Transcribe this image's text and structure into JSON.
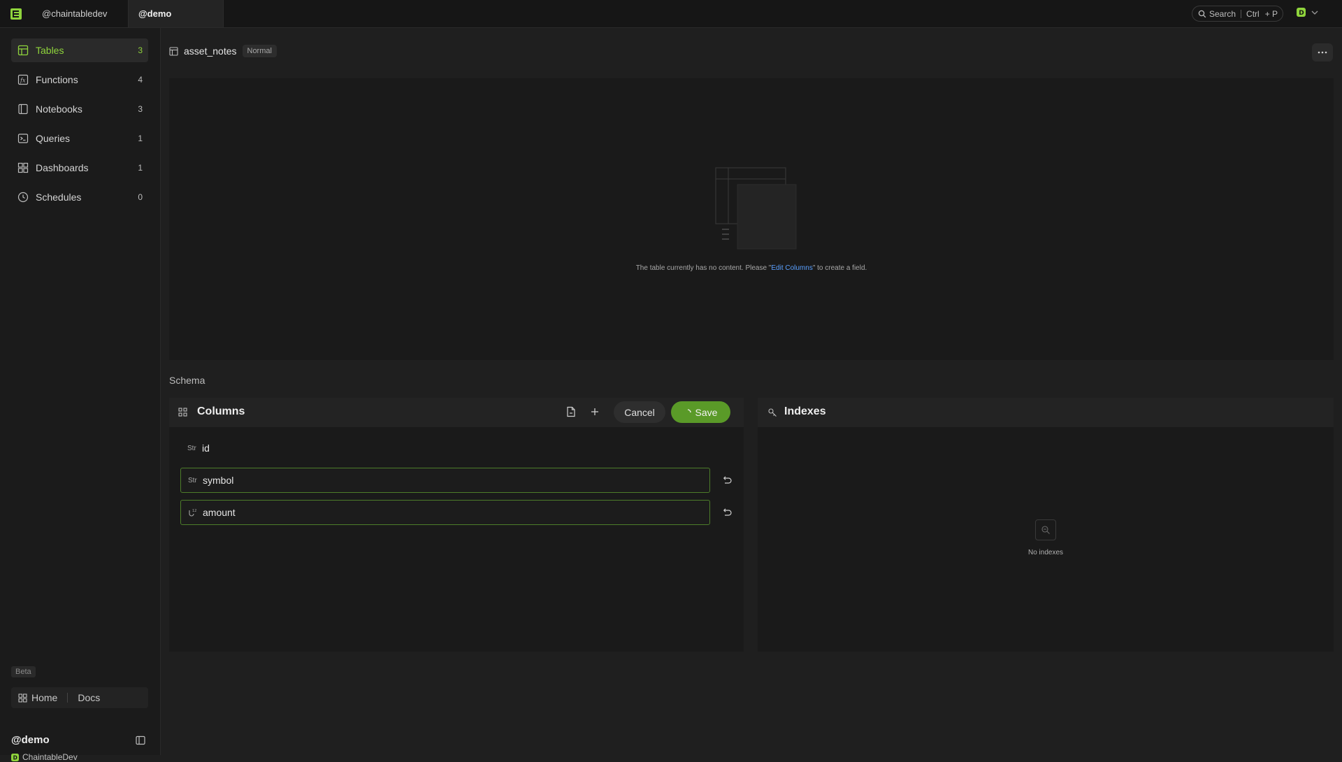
{
  "topbar": {
    "tabs": [
      "@chaintabledev",
      "@demo"
    ],
    "search": {
      "label": "Search",
      "shortcut_mod": "Ctrl",
      "shortcut_key": "+ P"
    },
    "user_initial": "D"
  },
  "sidebar": {
    "items": [
      {
        "label": "Tables",
        "count": "3",
        "icon": "table-icon",
        "active": true
      },
      {
        "label": "Functions",
        "count": "4",
        "icon": "function-icon"
      },
      {
        "label": "Notebooks",
        "count": "3",
        "icon": "notebook-icon"
      },
      {
        "label": "Queries",
        "count": "1",
        "icon": "terminal-icon"
      },
      {
        "label": "Dashboards",
        "count": "1",
        "icon": "dashboard-icon"
      },
      {
        "label": "Schedules",
        "count": "0",
        "icon": "clock-icon"
      }
    ],
    "beta": "Beta",
    "home": "Home",
    "docs": "Docs",
    "workspace": "@demo",
    "org": "ChaintableDev"
  },
  "table": {
    "name": "asset_notes",
    "badge": "Normal",
    "empty_message_pre": "The table currently has no content. Please \"",
    "empty_message_link": "Edit Columns",
    "empty_message_post": "\" to create a field."
  },
  "schema": {
    "label": "Schema",
    "columns": {
      "title": "Columns",
      "cancel": "Cancel",
      "save": "Save",
      "rows": [
        {
          "type": "Str",
          "name": "id",
          "editing": false
        },
        {
          "type": "Str",
          "name": "symbol",
          "editing": true
        },
        {
          "type": "num",
          "name": "amount",
          "editing": true
        }
      ]
    },
    "indexes": {
      "title": "Indexes",
      "empty": "No indexes"
    }
  },
  "colors": {
    "accent": "#8fd43c",
    "save": "#5a9a28",
    "link": "#5aa0ff",
    "edit_border": "#4d7d2a"
  }
}
